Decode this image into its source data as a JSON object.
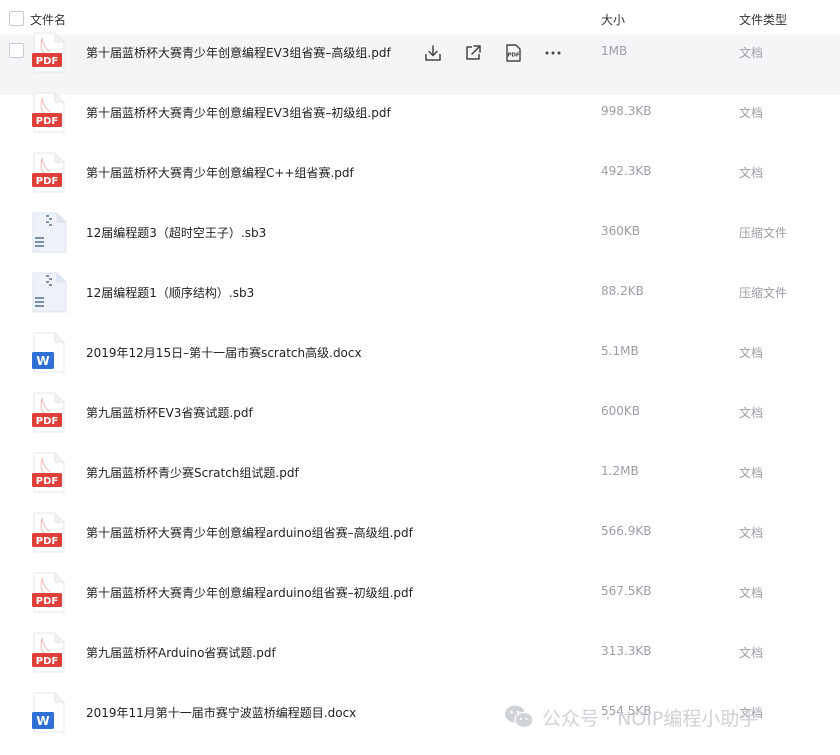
{
  "header": {
    "name": "文件名",
    "size": "大小",
    "type": "文件类型"
  },
  "rows": [
    {
      "name": "第十届蓝桥杯大赛青少年创意编程EV3组省赛–高级组.pdf",
      "size": "1MB",
      "type": "文档",
      "icon": "pdf-icon"
    },
    {
      "name": "第十届蓝桥杯大赛青少年创意编程EV3组省赛–初级组.pdf",
      "size": "998.3KB",
      "type": "文档",
      "icon": "pdf-icon"
    },
    {
      "name": "第十届蓝桥杯大赛青少年创意编程C++组省赛.pdf",
      "size": "492.3KB",
      "type": "文档",
      "icon": "pdf-icon"
    },
    {
      "name": "12届编程题3（超时空王子）.sb3",
      "size": "360KB",
      "type": "压缩文件",
      "icon": "archive-icon"
    },
    {
      "name": "12届编程题1（顺序结构）.sb3",
      "size": "88.2KB",
      "type": "压缩文件",
      "icon": "archive-icon"
    },
    {
      "name": "2019年12月15日–第十一届市赛scratch高级.docx",
      "size": "5.1MB",
      "type": "文档",
      "icon": "word-icon"
    },
    {
      "name": "第九届蓝桥杯EV3省赛试题.pdf",
      "size": "600KB",
      "type": "文档",
      "icon": "pdf-icon"
    },
    {
      "name": "第九届蓝桥杯青少赛Scratch组试题.pdf",
      "size": "1.2MB",
      "type": "文档",
      "icon": "pdf-icon"
    },
    {
      "name": "第十届蓝桥杯大赛青少年创意编程arduino组省赛–高级组.pdf",
      "size": "566.9KB",
      "type": "文档",
      "icon": "pdf-icon"
    },
    {
      "name": "第十届蓝桥杯大赛青少年创意编程arduino组省赛–初级组.pdf",
      "size": "567.5KB",
      "type": "文档",
      "icon": "pdf-icon"
    },
    {
      "name": "第九届蓝桥杯Arduino省赛试题.pdf",
      "size": "313.3KB",
      "type": "文档",
      "icon": "pdf-icon"
    },
    {
      "name": "2019年11月第十一届市赛宁波蓝桥编程题目.docx",
      "size": "554.5KB",
      "type": "文档",
      "icon": "word-icon"
    }
  ],
  "pdf_icon_label": "PDF",
  "word_icon_label": "W",
  "watermark": {
    "text": "公众号 · NOIP编程小助手",
    "icon": "wechat-icon"
  },
  "colors": {
    "pdf": "#e0403a",
    "word": "#2f6fd6",
    "archive": "#7d8fa8",
    "hover_row": "#f4f5f7"
  }
}
